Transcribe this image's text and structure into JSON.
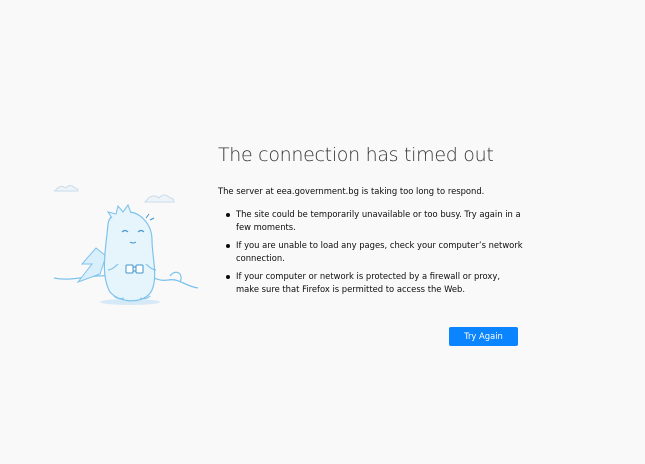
{
  "error_page": {
    "title": "The connection has timed out",
    "description": "The server at eea.government.bg is taking too long to respond.",
    "reasons": [
      "The site could be temporarily unavailable or too busy. Try again in a few moments.",
      "If you are unable to load any pages, check your computer’s network connection.",
      "If your computer or network is protected by a firewall or proxy, make sure that Firefox is permitted to access the Web."
    ],
    "try_again_label": "Try Again",
    "illustration_icon": "dino-unplugged-cable-icon",
    "accent_color": "#0a84ff"
  }
}
